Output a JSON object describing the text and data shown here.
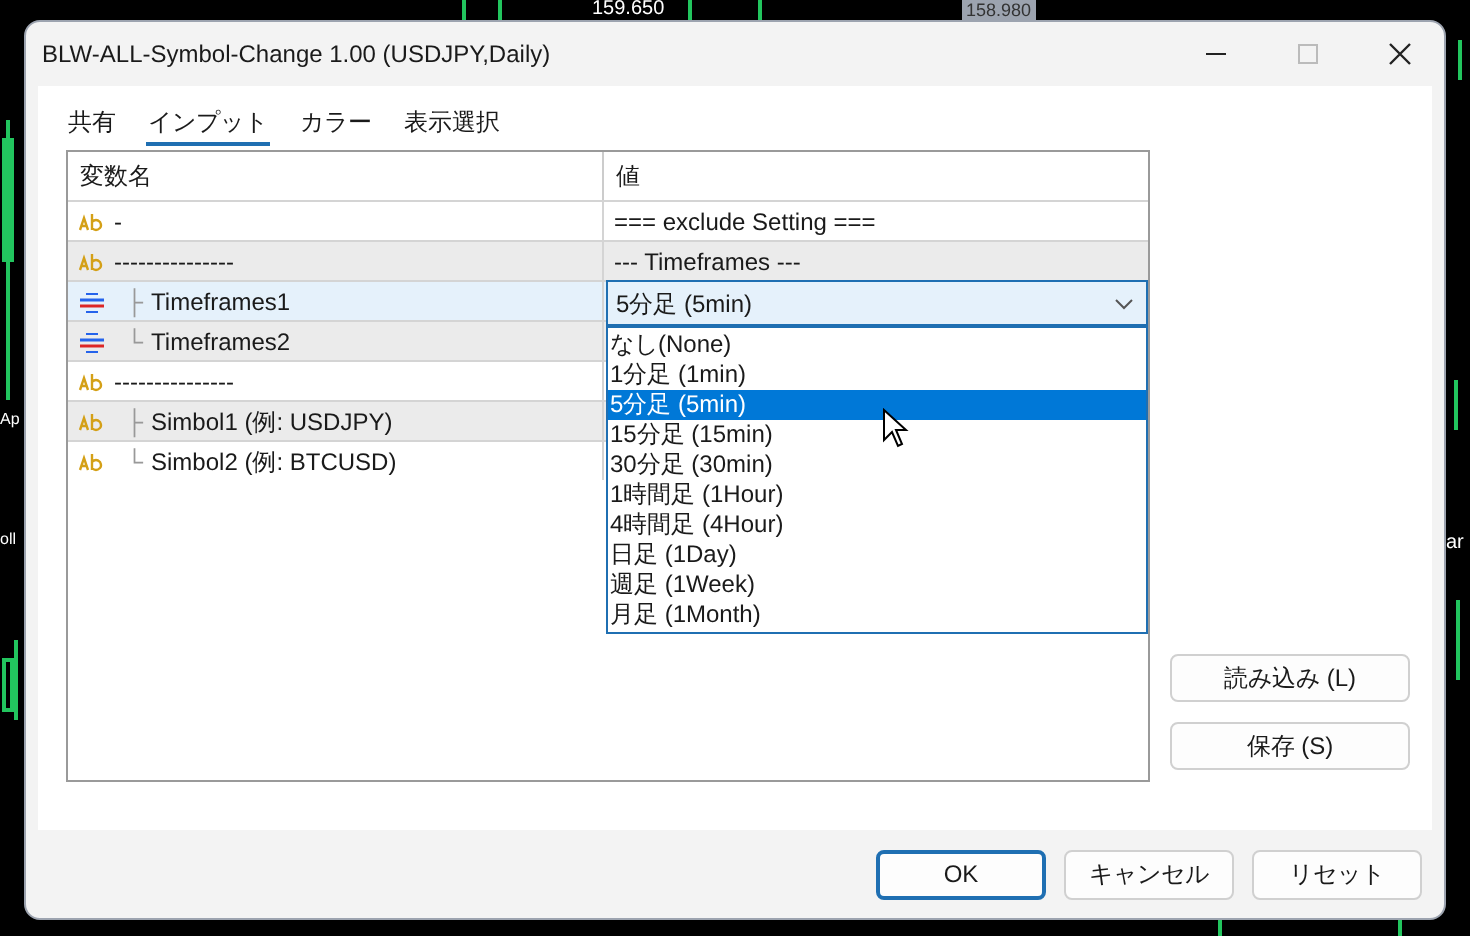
{
  "background": {
    "price_labels": [
      "159.650",
      "158.980"
    ],
    "side_labels": [
      "Ap",
      "oll",
      "ar"
    ]
  },
  "window": {
    "title": "BLW-ALL-Symbol-Change 1.00 (USDJPY,Daily)"
  },
  "tabs": [
    {
      "label": "共有",
      "selected": false
    },
    {
      "label": "インプット",
      "selected": true
    },
    {
      "label": "カラー",
      "selected": false
    },
    {
      "label": "表示選択",
      "selected": false
    }
  ],
  "table": {
    "columns": [
      "変数名",
      "値"
    ],
    "rows": [
      {
        "kind": "string",
        "name": "-",
        "value": "=== exclude Setting ===",
        "selected": false
      },
      {
        "kind": "string",
        "name": "---------------",
        "value": "--- Timeframes ---",
        "selected": false
      },
      {
        "kind": "enum",
        "connector": "├",
        "name": "Timeframes1",
        "selected": true
      },
      {
        "kind": "enum",
        "connector": "└",
        "name": "Timeframes2",
        "selected": false
      },
      {
        "kind": "string",
        "name": "---------------",
        "selected": false
      },
      {
        "kind": "string",
        "connector": "├",
        "name": "Simbol1 (例: USDJPY)",
        "selected": false
      },
      {
        "kind": "string",
        "connector": "└",
        "name": "Simbol2 (例: BTCUSD)",
        "selected": false
      }
    ]
  },
  "dropdown": {
    "value": "5分足 (5min)",
    "options": [
      {
        "label": "なし(None)",
        "selected": false
      },
      {
        "label": "1分足 (1min)",
        "selected": false
      },
      {
        "label": "5分足 (5min)",
        "selected": true
      },
      {
        "label": "15分足 (15min)",
        "selected": false
      },
      {
        "label": "30分足 (30min)",
        "selected": false
      },
      {
        "label": "1時間足 (1Hour)",
        "selected": false
      },
      {
        "label": "4時間足 (4Hour)",
        "selected": false
      },
      {
        "label": "日足 (1Day)",
        "selected": false
      },
      {
        "label": "週足 (1Week)",
        "selected": false
      },
      {
        "label": "月足 (1Month)",
        "selected": false
      }
    ]
  },
  "side_buttons": [
    "読み込み (L)",
    "保存 (S)"
  ],
  "buttons": [
    {
      "label": "OK",
      "default": true
    },
    {
      "label": "キャンセル",
      "default": false
    },
    {
      "label": "リセット",
      "default": false
    }
  ]
}
